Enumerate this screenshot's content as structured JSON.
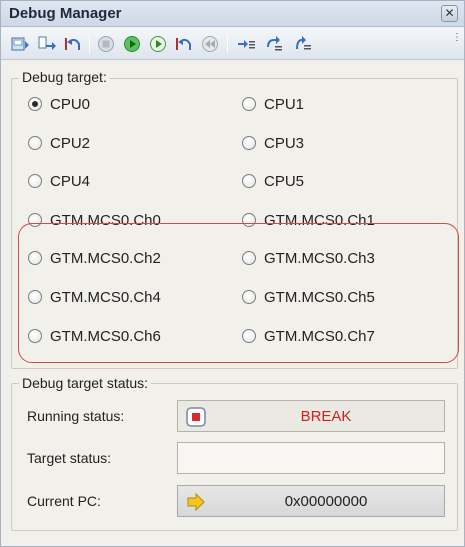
{
  "window": {
    "title": "Debug Manager",
    "close_glyph": "✕"
  },
  "toolbar": {
    "icons": [
      "download-icon",
      "step-into-icon",
      "step-back-icon",
      "stop-icon",
      "go-icon",
      "run-icon",
      "return-icon",
      "rewind-icon",
      "next-icon",
      "step-over-icon",
      "return-out-icon"
    ],
    "overflow_glyph": "⋮"
  },
  "debug_target": {
    "label": "Debug target:",
    "selected": "CPU0",
    "options": [
      "CPU0",
      "CPU1",
      "CPU2",
      "CPU3",
      "CPU4",
      "CPU5",
      "GTM.MCS0.Ch0",
      "GTM.MCS0.Ch1",
      "GTM.MCS0.Ch2",
      "GTM.MCS0.Ch3",
      "GTM.MCS0.Ch4",
      "GTM.MCS0.Ch5",
      "GTM.MCS0.Ch6",
      "GTM.MCS0.Ch7"
    ]
  },
  "target_status": {
    "label": "Debug target status:",
    "running_label": "Running status:",
    "running_value": "BREAK",
    "running_color": "#d11f1f",
    "target_label": "Target status:",
    "target_value": "",
    "pc_label": "Current PC:",
    "pc_value": "0x00000000"
  },
  "colors": {
    "highlight": "#d24a4a",
    "panel": "#f2f0eb"
  }
}
